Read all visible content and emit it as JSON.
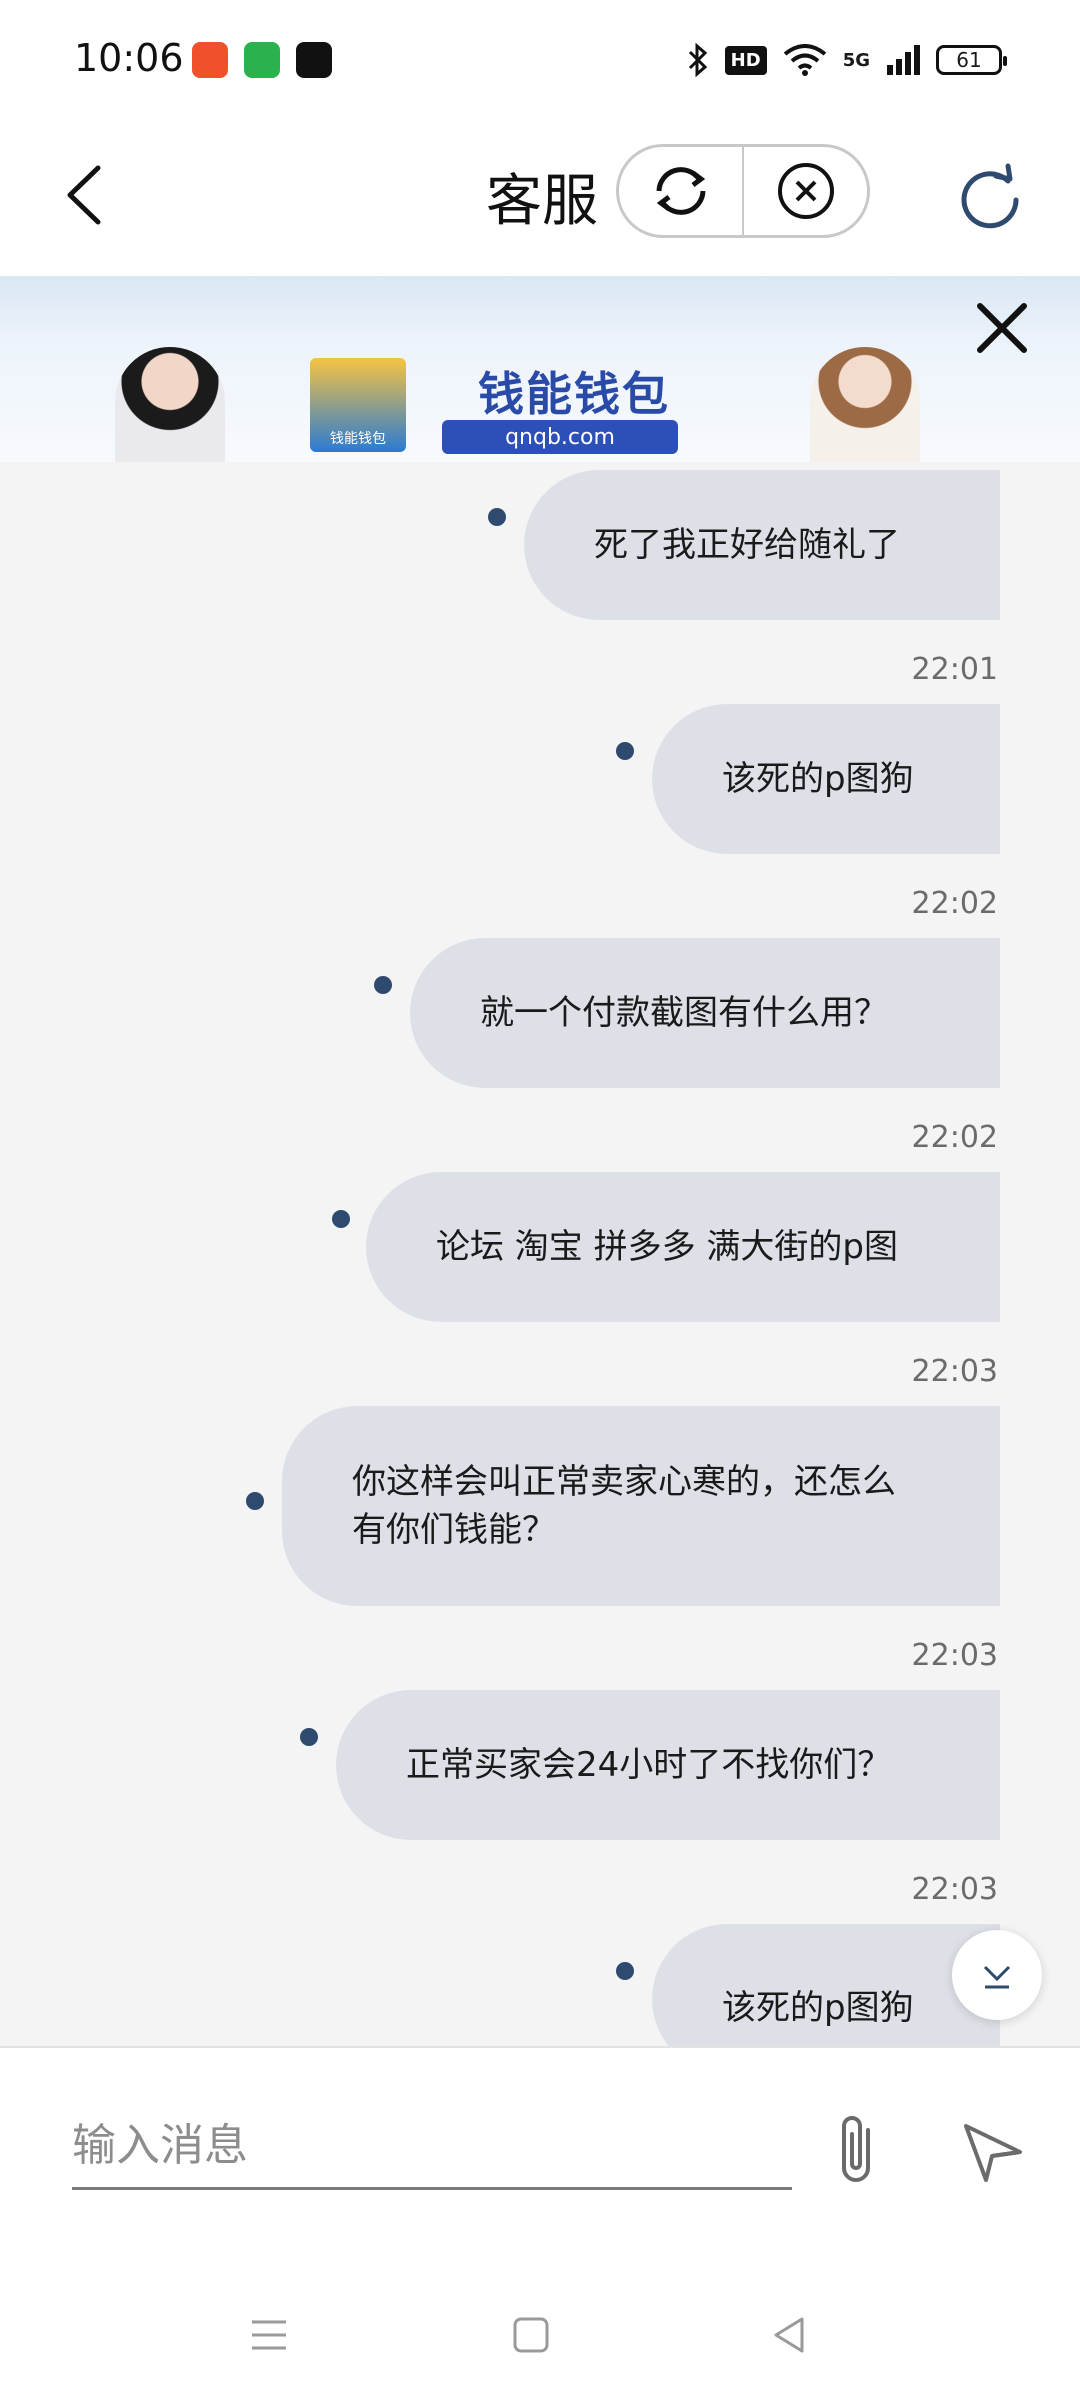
{
  "status_bar": {
    "time": "10:06",
    "battery": "61",
    "network": "5G",
    "hd": "HD"
  },
  "header": {
    "title": "客服"
  },
  "banner": {
    "brand": "钱能钱包",
    "domain": "qnqb.com",
    "logo_caption": "钱能钱包"
  },
  "messages": [
    {
      "text": "死了我正好给随礼了",
      "time": "22:01"
    },
    {
      "text": "该死的p图狗",
      "time": "22:02"
    },
    {
      "text": "就一个付款截图有什么用？",
      "time": "22:02"
    },
    {
      "text": "论坛 淘宝 拼多多 满大街的p图",
      "time": "22:03"
    },
    {
      "text": "你这样会叫正常卖家心寒的，还怎么有你们钱能？",
      "time": "22:03"
    },
    {
      "text": "正常买家会24小时了不找你们？",
      "time": "22:03"
    },
    {
      "text": "该死的p图狗",
      "time": ""
    }
  ],
  "input": {
    "placeholder": "输入消息"
  },
  "colors": {
    "bubble": "#dde1e7",
    "chat_bg": "#f4f4f4",
    "dot": "#2e4a6e",
    "brand_blue": "#2d50b8"
  }
}
